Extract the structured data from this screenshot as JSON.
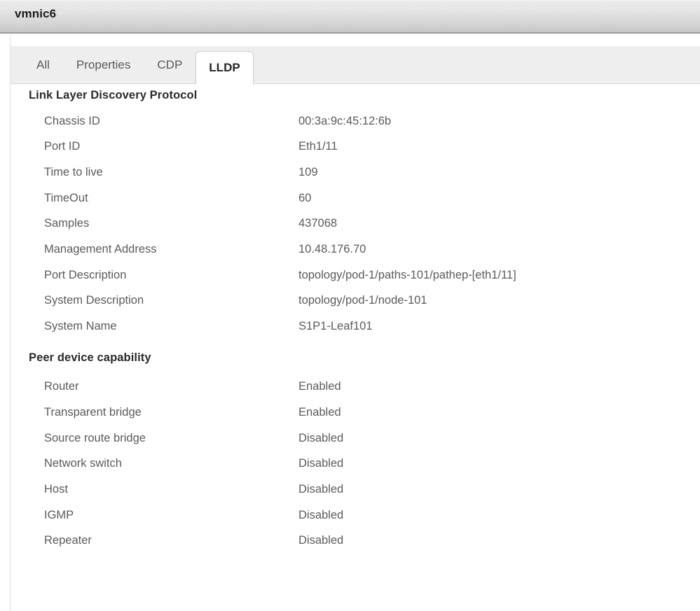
{
  "window": {
    "title": "vmnic6"
  },
  "tabs": [
    {
      "label": "All",
      "active": false
    },
    {
      "label": "Properties",
      "active": false
    },
    {
      "label": "CDP",
      "active": false
    },
    {
      "label": "LLDP",
      "active": true
    }
  ],
  "sections": [
    {
      "heading": "Link Layer Discovery Protocol",
      "rows": [
        {
          "label": "Chassis ID",
          "value": "00:3a:9c:45:12:6b"
        },
        {
          "label": "Port ID",
          "value": "Eth1/11"
        },
        {
          "label": "Time to live",
          "value": "109"
        },
        {
          "label": "TimeOut",
          "value": "60"
        },
        {
          "label": "Samples",
          "value": "437068"
        },
        {
          "label": "Management Address",
          "value": "10.48.176.70"
        },
        {
          "label": "Port Description",
          "value": "topology/pod-1/paths-101/pathep-[eth1/11]"
        },
        {
          "label": "System Description",
          "value": "topology/pod-1/node-101"
        },
        {
          "label": "System Name",
          "value": "S1P1-Leaf101"
        }
      ]
    },
    {
      "heading": "Peer device capability",
      "rows": [
        {
          "label": "Router",
          "value": "Enabled"
        },
        {
          "label": "Transparent bridge",
          "value": "Enabled"
        },
        {
          "label": "Source route bridge",
          "value": "Disabled"
        },
        {
          "label": "Network switch",
          "value": "Disabled"
        },
        {
          "label": "Host",
          "value": "Disabled"
        },
        {
          "label": "IGMP",
          "value": "Disabled"
        },
        {
          "label": "Repeater",
          "value": "Disabled"
        }
      ]
    }
  ],
  "colors": {
    "titlebar_top": "#ececec",
    "titlebar_bottom": "#c6c6c6",
    "tabstrip_bg": "#efeeee",
    "active_tab_bg": "#ffffff",
    "content_bg": "#ffffff",
    "label_text": "#5b5b5b",
    "heading_text": "#2b2b2b",
    "title_text": "#1b1b1b"
  }
}
